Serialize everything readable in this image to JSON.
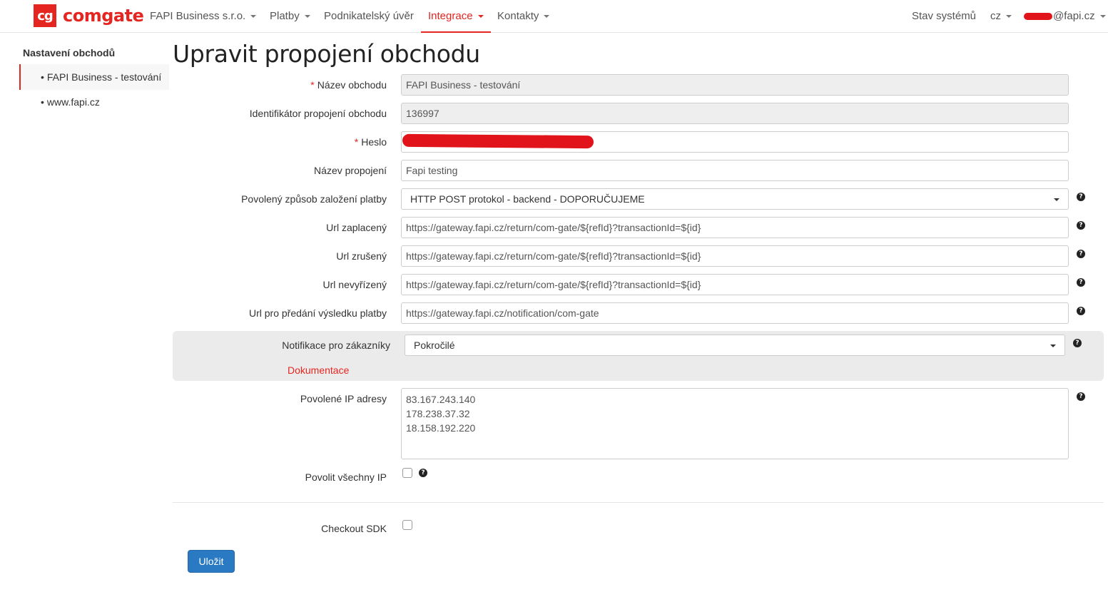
{
  "header": {
    "logo_mark": "cg",
    "logo_text": "comgate",
    "company": "FAPI Business s.r.o.",
    "nav": {
      "platby": "Platby",
      "uver": "Podnikatelský úvěr",
      "integrace": "Integrace",
      "kontakty": "Kontakty"
    },
    "status": "Stav systémů",
    "language": "cz",
    "user_email_suffix": "@fapi.cz",
    "accent_color": "#e52520"
  },
  "sidebar": {
    "title": "Nastavení obchodů",
    "items": [
      {
        "label": "FAPI Business - testování",
        "active": true
      },
      {
        "label": "www.fapi.cz",
        "active": false
      }
    ]
  },
  "page": {
    "title": "Upravit propojení obchodu"
  },
  "form": {
    "shop_name": {
      "label": "Název obchodu",
      "value": "FAPI Business - testování",
      "required": true
    },
    "connection_id": {
      "label": "Identifikátor propojení obchodu",
      "value": "136997"
    },
    "password": {
      "label": "Heslo",
      "required": true
    },
    "connection_name": {
      "label": "Název propojení",
      "value": "Fapi testing"
    },
    "payment_method": {
      "label": "Povolený způsob založení platby",
      "value": "HTTP POST protokol - backend - DOPORUČUJEME"
    },
    "url_paid": {
      "label": "Url zaplacený",
      "value": "https://gateway.fapi.cz/return/com-gate/${refId}?transactionId=${id}"
    },
    "url_cancelled": {
      "label": "Url zrušený",
      "value": "https://gateway.fapi.cz/return/com-gate/${refId}?transactionId=${id}"
    },
    "url_pending": {
      "label": "Url nevyřízený",
      "value": "https://gateway.fapi.cz/return/com-gate/${refId}?transactionId=${id}"
    },
    "url_result": {
      "label": "Url pro předání výsledku platby",
      "value": "https://gateway.fapi.cz/notification/com-gate"
    },
    "customer_notifications": {
      "label": "Notifikace pro zákazníky",
      "value": "Pokročilé",
      "doc_link": "Dokumentace"
    },
    "allowed_ips": {
      "label": "Povolené IP adresy",
      "lines": [
        "83.167.243.140",
        "178.238.37.32",
        "18.158.192.220"
      ]
    },
    "allow_all_ip": {
      "label": "Povolit všechny IP",
      "checked": false
    },
    "checkout_sdk": {
      "label": "Checkout SDK",
      "checked": false
    },
    "help_glyph": "?",
    "save_label": "Uložit"
  }
}
